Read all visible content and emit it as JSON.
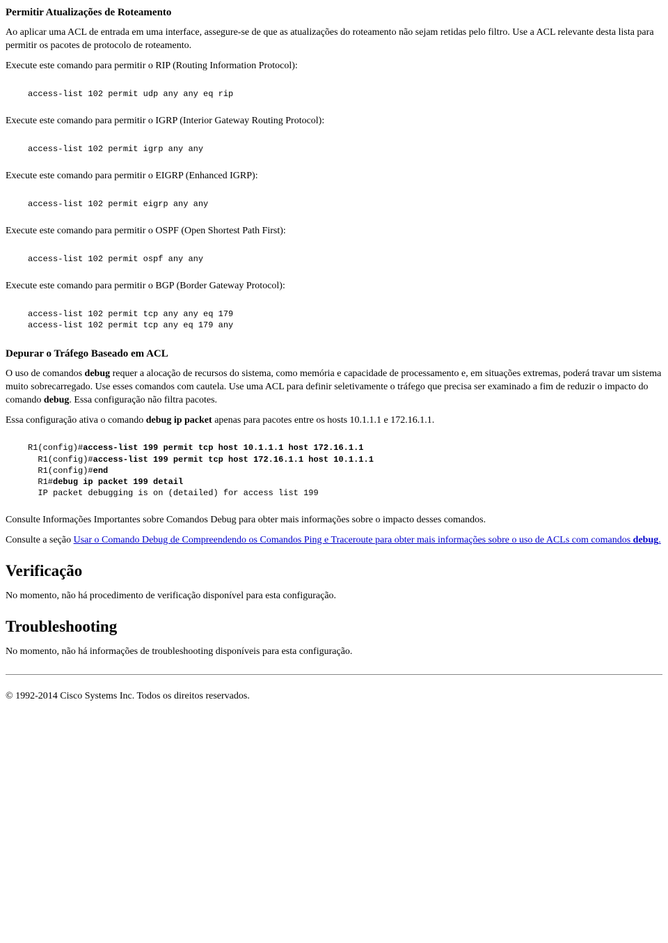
{
  "section1": {
    "title": "Permitir Atualizações de Roteamento",
    "intro": "Ao aplicar uma ACL de entrada em uma interface, assegure-se de que as atualizações do roteamento não sejam retidas pelo filtro. Use a ACL relevante desta lista para permitir os pacotes de protocolo de roteamento.",
    "rip_text": "Execute este comando para permitir o RIP (Routing Information Protocol):",
    "rip_code": "access-list 102 permit udp any any eq rip",
    "igrp_text": "Execute este comando para permitir o IGRP (Interior Gateway Routing Protocol):",
    "igrp_code": "access-list 102 permit igrp any any",
    "eigrp_text": "Execute este comando para permitir o EIGRP (Enhanced IGRP):",
    "eigrp_code": "access-list 102 permit eigrp any any",
    "ospf_text": "Execute este comando para permitir o OSPF (Open Shortest Path First):",
    "ospf_code": "access-list 102 permit ospf any any",
    "bgp_text": "Execute este comando para permitir o BGP (Border Gateway Protocol):",
    "bgp_code": "access-list 102 permit tcp any any eq 179\naccess-list 102 permit tcp any eq 179 any"
  },
  "section2": {
    "title": "Depurar o Tráfego Baseado em ACL",
    "para1_a": "O uso de comandos ",
    "para1_b": "debug",
    "para1_c": " requer a alocação de recursos do sistema, como memória e capacidade de processamento e, em situações extremas, poderá travar um sistema muito sobrecarregado. Use esses comandos com cautela. Use uma ACL para definir seletivamente o tráfego que precisa ser examinado a fim de reduzir o impacto do comando ",
    "para1_d": "debug",
    "para1_e": ". Essa configuração não filtra pacotes.",
    "para2_a": "Essa configuração ativa o comando ",
    "para2_b": "debug ip packet",
    "para2_c": " apenas para pacotes entre os hosts 10.1.1.1 e 172.16.1.1.",
    "code_pre1": "R1(config)#",
    "code_b1": "access-list 199 permit tcp host 10.1.1.1 host 172.16.1.1",
    "code_pre2": "\n  R1(config)#",
    "code_b2": "access-list 199 permit tcp host 172.16.1.1 host 10.1.1.1",
    "code_pre3": "\n  R1(config)#",
    "code_b3": "end",
    "code_pre4": "\n  R1#",
    "code_b4": "debug ip packet 199 detail",
    "code_tail": "\n  IP packet debugging is on (detailed) for access list 199",
    "after1": "Consulte Informações Importantes sobre Comandos Debug para obter mais informações sobre o impacto desses comandos.",
    "after2_a": "Consulte a seção ",
    "after2_link1": "Usar o Comando Debug de Compreendendo os Comandos Ping e Traceroute para obter mais informações sobre o uso de ACLs com comandos ",
    "after2_link_bold": "debug",
    "after2_link_tail": "."
  },
  "verif": {
    "title": "Verificação",
    "text": "No momento, não há procedimento de verificação disponível para esta configuração."
  },
  "trouble": {
    "title": "Troubleshooting",
    "text": "No momento, não há informações de troubleshooting disponíveis para esta configuração."
  },
  "footer": "© 1992-2014 Cisco Systems Inc. Todos os direitos reservados."
}
